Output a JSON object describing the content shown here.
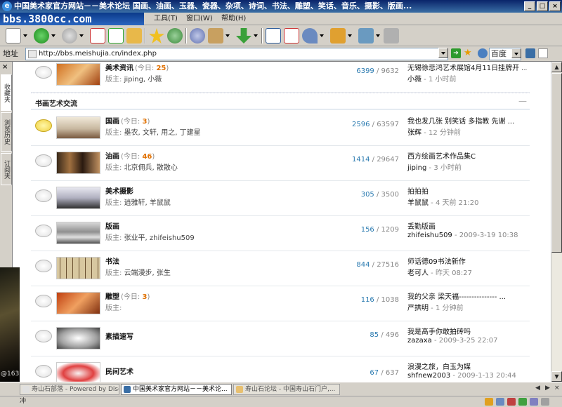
{
  "window": {
    "title": "中国美术家官方网站－－美术论坛 国画、油画、玉器、瓷器、杂项、诗词、书法、雕塑、笑话、音乐、摄影、版画..."
  },
  "menubar": {
    "logo_text": "bbs.3800cc.com",
    "items": [
      "工具(T)",
      "窗口(W)",
      "帮助(H)"
    ]
  },
  "addressbar": {
    "label": "地址",
    "url": "http://bbs.meishujia.cn/index.php",
    "search_engine": "百度"
  },
  "sidebar": {
    "tabs": [
      "收藏夹",
      "浏览历史",
      "订阅夹"
    ],
    "thumb_text": "@163"
  },
  "forum": {
    "top_row": {
      "name": "美术资讯",
      "today_label": "(今日:",
      "today": "25",
      "today_close": ")",
      "mods_label": "版主:",
      "mods": "jiping, 小薇",
      "topics": "6399",
      "sep": "/",
      "posts": "9632",
      "last_title": "无锡徐悲鸿艺术展馆4月11日挂牌开 ...",
      "last_user": "小薇",
      "last_time": " - 1 小时前"
    },
    "category": {
      "title": "书画艺术交流",
      "collapse": "—"
    },
    "rows": [
      {
        "name": "国画",
        "today_label": "(今日:",
        "today": "3",
        "today_close": ")",
        "mods_label": "版主:",
        "mods": "墨农, 文轩, 用之, 丁建星",
        "topics": "2596",
        "sep": "/",
        "posts": "63597",
        "last_title": "我也发几张  别笑话  多指教  先谢  ...",
        "last_user": "张辉",
        "last_time": " - 12 分钟前"
      },
      {
        "name": "油画",
        "today_label": "(今日:",
        "today": "46",
        "today_close": ")",
        "mods_label": "版主:",
        "mods": "北京佣兵, 散散心",
        "topics": "1414",
        "sep": "/",
        "posts": "29647",
        "last_title": "西方绘画艺术作品集C",
        "last_user": "jiping",
        "last_time": " - 3 小时前"
      },
      {
        "name": "美术摄影",
        "today_label": "",
        "today": "",
        "today_close": "",
        "mods_label": "版主:",
        "mods": "逍雅轩, 羊鼠鼠",
        "topics": "305",
        "sep": "/",
        "posts": "3500",
        "last_title": "拍拍拍",
        "last_user": "羊鼠鼠",
        "last_time": " - 4 天前 21:20"
      },
      {
        "name": "版画",
        "today_label": "",
        "today": "",
        "today_close": "",
        "mods_label": "版主:",
        "mods": "张业平, zhifeishu509",
        "topics": "156",
        "sep": "/",
        "posts": "1209",
        "last_title": "丢勤版画",
        "last_user": "zhifeishu509",
        "last_time": " - 2009-3-19 10:38"
      },
      {
        "name": "书法",
        "today_label": "",
        "today": "",
        "today_close": "",
        "mods_label": "版主:",
        "mods": "云端漫步, 张生",
        "topics": "844",
        "sep": "/",
        "posts": "27516",
        "last_title": "师话德09书法新作",
        "last_user": "老可人",
        "last_time": " - 昨天 08:27"
      },
      {
        "name": "雕塑",
        "today_label": "(今日:",
        "today": "3",
        "today_close": ")",
        "mods_label": "版主:",
        "mods": "",
        "topics": "116",
        "sep": "/",
        "posts": "1038",
        "last_title": "我的父亲  梁天福---------------  ...",
        "last_user": "严拱明",
        "last_time": " - 1 分钟前"
      },
      {
        "name": "素描速写",
        "today_label": "",
        "today": "",
        "today_close": "",
        "mods_label": "",
        "mods": "",
        "topics": "85",
        "sep": "/",
        "posts": "496",
        "last_title": "我是高手你敢拍砖吗",
        "last_user": "zazaxa",
        "last_time": " - 2009-3-25 22:07"
      },
      {
        "name": "民间艺术",
        "today_label": "",
        "today": "",
        "today_close": "",
        "mods_label": "",
        "mods": "",
        "topics": "67",
        "sep": "/",
        "posts": "637",
        "last_title": "浪漫之旅，白玉为媒",
        "last_user": "shfnew2003",
        "last_time": " - 2009-1-13 20:44"
      }
    ]
  },
  "browser_tabs": [
    {
      "label": "寿山石部落 - Powered by Disc..."
    },
    {
      "label": "中国美术家官方网站－－美术论..."
    },
    {
      "label": "寿山石论坛 - 中国寿山石门户,..."
    }
  ],
  "status": {
    "left_text": "冲"
  },
  "colors": {
    "accent_link": "#2a7ab0",
    "today_count": "#e07000",
    "title_bar": "#0a246a"
  }
}
